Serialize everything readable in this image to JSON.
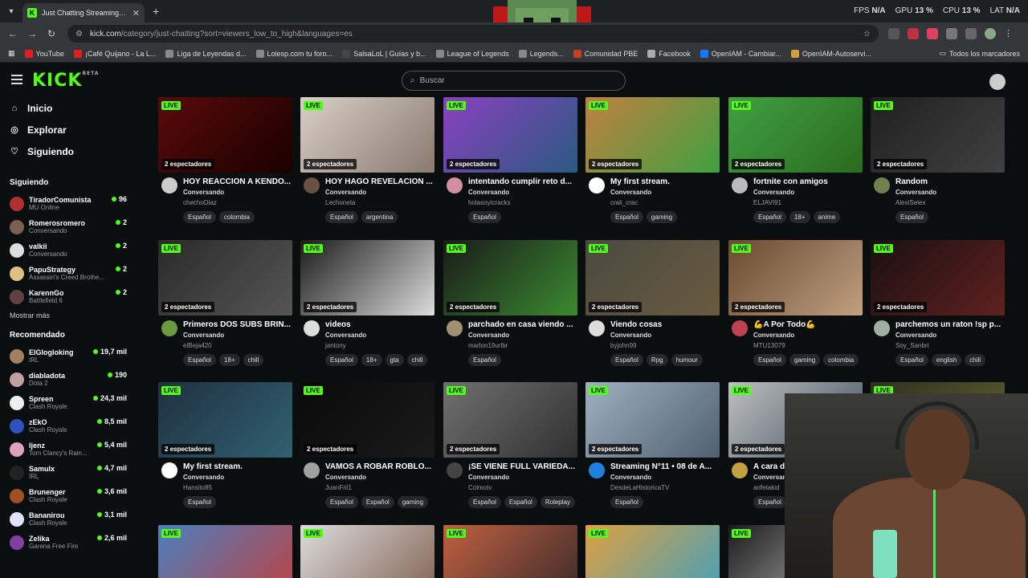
{
  "browser": {
    "tab_title": "Just Chatting Streaming - Live S",
    "url_host": "kick.com",
    "url_path": "/category/just-chatting?sort=viewers_low_to_high&languages=es",
    "stats": [
      {
        "label": "FPS",
        "value": "N/A"
      },
      {
        "label": "GPU",
        "value": "13 %"
      },
      {
        "label": "CPU",
        "value": "13 %"
      },
      {
        "label": "LAT",
        "value": "N/A"
      }
    ],
    "bookmarks": [
      "YouTube",
      "¡Café Quijano - La L...",
      "Liga de Leyendas d...",
      "Lolesp.com tu foro...",
      "SalsaLoL | Guías y b...",
      "League of Legends",
      "Legends...",
      "Comunidad PBE",
      "Facebook",
      "OpenIAM - Cambiar...",
      "OpenIAM-Autoservi..."
    ],
    "bookmarks_all": "Todos los marcadores"
  },
  "header": {
    "logo": "KICK",
    "logo_sup": "BETA",
    "search_placeholder": "Buscar"
  },
  "sidebar": {
    "nav": [
      {
        "label": "Inicio",
        "icon": "home-icon"
      },
      {
        "label": "Explorar",
        "icon": "compass-icon"
      },
      {
        "label": "Siguiendo",
        "icon": "heart-icon"
      }
    ],
    "following_title": "Siguiendo",
    "following": [
      {
        "name": "TiradorComunista",
        "game": "MU Online",
        "viewers": "96",
        "color": "#b03030"
      },
      {
        "name": "Romerosromero",
        "game": "Conversando",
        "viewers": "2",
        "color": "#7a6050"
      },
      {
        "name": "valkii",
        "game": "Conversando",
        "viewers": "2",
        "color": "#ddd"
      },
      {
        "name": "PapuStrategy",
        "game": "Assassin's Creed Brothe...",
        "viewers": "2",
        "color": "#e0c080"
      },
      {
        "name": "KarennGo",
        "game": "Battlefield 6",
        "viewers": "2",
        "color": "#604040"
      }
    ],
    "show_more": "Mostrar más",
    "recommended_title": "Recomendado",
    "recommended": [
      {
        "name": "ElGlogloking",
        "game": "IRL",
        "viewers": "19,7 mil",
        "color": "#a08060"
      },
      {
        "name": "diabladota",
        "game": "Dota 2",
        "viewers": "190",
        "color": "#c0a0a0"
      },
      {
        "name": "Spreen",
        "game": "Clash Royale",
        "viewers": "24,3 mil",
        "color": "#eee"
      },
      {
        "name": "zEkO",
        "game": "Clash Royale",
        "viewers": "8,5 mil",
        "color": "#3050c0"
      },
      {
        "name": "ljenz",
        "game": "Tom Clancy's Rain...",
        "viewers": "5,4 mil",
        "color": "#e0a0c0"
      },
      {
        "name": "Samulx",
        "game": "IRL",
        "viewers": "4,7 mil",
        "color": "#222"
      },
      {
        "name": "Brunenger",
        "game": "Clash Royale",
        "viewers": "3,6 mil",
        "color": "#a05020"
      },
      {
        "name": "Bananirou",
        "game": "Clash Royale",
        "viewers": "3,1 mil",
        "color": "#e0e0ff"
      },
      {
        "name": "Zelika",
        "game": "Garena Free Fire",
        "viewers": "2,6 mil",
        "color": "#8040a0"
      }
    ]
  },
  "streams": [
    {
      "title": "HOY REACCION A KENDO...",
      "category": "Conversando",
      "user": "chechoDiaz",
      "tags": [
        "Español",
        "colombia"
      ],
      "thumb": "#5a0a0a",
      "thumb2": "#1a0000",
      "avatar": "#ccc"
    },
    {
      "title": "HOY HAGO REVELACION ...",
      "category": "Conversando",
      "user": "Lechoneta",
      "tags": [
        "Español",
        "argentina"
      ],
      "thumb": "#d8d0c8",
      "thumb2": "#8a7a70",
      "avatar": "#6a5040"
    },
    {
      "title": "intentando cumplir reto d...",
      "category": "Conversando",
      "user": "holasoyicracks",
      "tags": [
        "Español"
      ],
      "thumb": "#8a40c0",
      "thumb2": "#2a5a80",
      "avatar": "#d090a0"
    },
    {
      "title": "My first stream.",
      "category": "Conversando",
      "user": "crali_crac",
      "tags": [
        "Español",
        "gaming"
      ],
      "thumb": "#c08040",
      "thumb2": "#40a040",
      "avatar": "#fff"
    },
    {
      "title": "fortnite con amigos",
      "category": "Conversando",
      "user": "ELJAVI91",
      "tags": [
        "Español",
        "18+",
        "anime"
      ],
      "thumb": "#40a040",
      "thumb2": "#2a6a20",
      "avatar": "#bbb"
    },
    {
      "title": "Random",
      "category": "Conversando",
      "user": "AlexiSelex",
      "tags": [
        "Español"
      ],
      "thumb": "#202020",
      "thumb2": "#404040",
      "avatar": "#708050"
    },
    {
      "title": "Primeros DOS SUBS BRIN...",
      "category": "Conversando",
      "user": "elBeja420",
      "tags": [
        "Español",
        "18+",
        "chill"
      ],
      "thumb": "#2a2a2a",
      "thumb2": "#555",
      "avatar": "#6a9a40"
    },
    {
      "title": "videos",
      "category": "Conversando",
      "user": "jantony",
      "tags": [
        "Español",
        "18+",
        "gta",
        "chill"
      ],
      "thumb": "#1a1a1a",
      "thumb2": "#ddd",
      "avatar": "#ddd"
    },
    {
      "title": "parchado en casa viendo ...",
      "category": "Conversando",
      "user": "marlon19urlbr",
      "tags": [
        "Español"
      ],
      "thumb": "#1a1a1a",
      "thumb2": "#3a8a30",
      "avatar": "#a09070"
    },
    {
      "title": "Viendo cosas",
      "category": "Conversando",
      "user": "byjohn99",
      "tags": [
        "Español",
        "Rpg",
        "humour"
      ],
      "thumb": "#4a4a40",
      "thumb2": "#6a5a40",
      "avatar": "#ddd"
    },
    {
      "title": "💪A Por Todo💪",
      "category": "Conversando",
      "user": "MTU13079",
      "tags": [
        "Español",
        "gaming",
        "colombia"
      ],
      "thumb": "#6a4a30",
      "thumb2": "#c0a080",
      "avatar": "#c04050"
    },
    {
      "title": "parchemos un raton !sp p...",
      "category": "Conversando",
      "user": "Soy_Sanbri",
      "tags": [
        "Español",
        "english",
        "chill"
      ],
      "thumb": "#1a1010",
      "thumb2": "#602020",
      "avatar": "#a0b0a0"
    },
    {
      "title": "My first stream.",
      "category": "Conversando",
      "user": "Hansito85",
      "tags": [
        "Español"
      ],
      "thumb": "#203040",
      "thumb2": "#306070",
      "avatar": "#fff"
    },
    {
      "title": "VAMOS A ROBAR ROBLO...",
      "category": "Conversando",
      "user": "JuanFrii1",
      "tags": [
        "Español",
        "Español",
        "gaming"
      ],
      "thumb": "#0a0a0a",
      "thumb2": "#1a1a1a",
      "avatar": "#a0a0a0"
    },
    {
      "title": "¡SE VIENE FULL VARIEDA...",
      "category": "Conversando",
      "user": "Colmotv",
      "tags": [
        "Español",
        "Español",
        "Roleplay"
      ],
      "thumb": "#707070",
      "thumb2": "#303030",
      "avatar": "#444"
    },
    {
      "title": "Streaming N°11 • 08 de A...",
      "category": "Conversando",
      "user": "DesdeLaHistoricaTV",
      "tags": [
        "Español"
      ],
      "thumb": "#a0b0c0",
      "thumb2": "#506070",
      "avatar": "#2080e0"
    },
    {
      "title": "A cara de...",
      "category": "Conversando",
      "user": "anfetakid",
      "tags": [
        "Español"
      ],
      "thumb": "#c0c0c0",
      "thumb2": "#405060",
      "avatar": "#c0a040"
    },
    {
      "title": "",
      "category": "",
      "user": "",
      "tags": [],
      "thumb": "#303020",
      "thumb2": "#606030",
      "avatar": "#333"
    },
    {
      "title": "",
      "category": "",
      "user": "",
      "tags": [],
      "thumb": "#4a80c0",
      "thumb2": "#c04040",
      "avatar": "#333"
    },
    {
      "title": "",
      "category": "",
      "user": "",
      "tags": [],
      "thumb": "#ddd",
      "thumb2": "#806050",
      "avatar": "#333"
    },
    {
      "title": "",
      "category": "",
      "user": "",
      "tags": [],
      "thumb": "#c06040",
      "thumb2": "#3a2a2a",
      "avatar": "#333"
    },
    {
      "title": "",
      "category": "",
      "user": "",
      "tags": [],
      "thumb": "#e0a040",
      "thumb2": "#40a0c0",
      "avatar": "#333"
    },
    {
      "title": "",
      "category": "",
      "user": "",
      "tags": [],
      "thumb": "#1a1a1a",
      "thumb2": "#c0c0c0",
      "avatar": "#333"
    },
    {
      "title": "",
      "category": "",
      "user": "",
      "tags": [],
      "thumb": "#202020",
      "thumb2": "#a04040",
      "avatar": "#333"
    }
  ],
  "live_label": "LIVE",
  "viewers_label": "2 espectadores"
}
